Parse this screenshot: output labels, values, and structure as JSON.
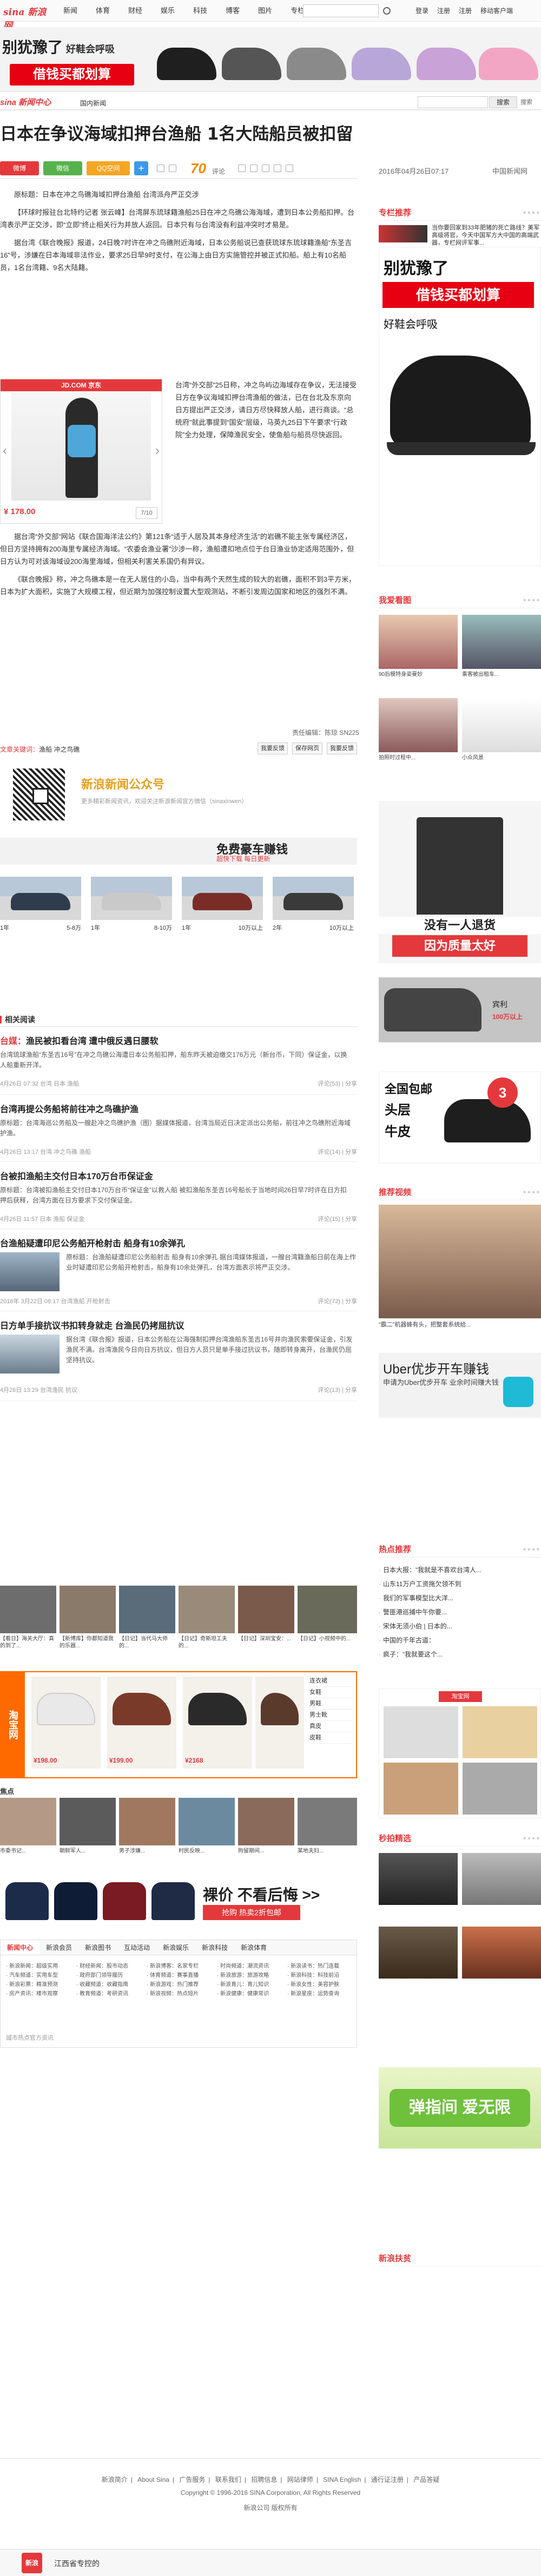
{
  "topnav": {
    "logo": "sina 新浪网",
    "items": [
      "新闻",
      "体育",
      "财经",
      "娱乐",
      "科技",
      "博客",
      "图片",
      "专栏",
      "更多"
    ],
    "links": [
      "登录",
      "注册",
      "注册",
      "移动客户端"
    ]
  },
  "banner": {
    "title": "别犹豫了",
    "title_small": "好鞋会呼吸",
    "red": "借钱买都划算",
    "shoe_colors": [
      "#1f1f1f",
      "#555",
      "#8a8a8a",
      "#b8a6d8",
      "#c9a2d8",
      "#f2a6c4"
    ]
  },
  "channel": {
    "logo": "sina 新闻中心",
    "link": "国内新闻",
    "search_btn": "搜索",
    "icon": "搜索"
  },
  "headline": "日本在争议海域扣押台渔船 1名大陆船员被扣留",
  "share": {
    "buttons": [
      "微博",
      "微信",
      "QQ空间"
    ],
    "comments": "70",
    "comment_label": "评论",
    "date": "2016年04月26日07:17",
    "source": "中国新闻网"
  },
  "article": {
    "p1": "原标题：日本在冲之鸟礁海域扣押台渔船 台湾派舟严正交涉",
    "p2": "【环球时报驻台北特约记者 张云峰】台湾屏东琉球籍渔船25日在冲之鸟礁公海海域，遭到日本公务船扣押。台湾表示严正交涉，即“立即”终止相关行为并放人返回。日本只有与台湾没有利益冲突时才易是。",
    "p3": "据台湾《联合晚报》报道，24日晚7时许在冲之鸟礁附近海域，日本公务船说已查获琉球东琉球籍渔船“东圣吉16”号，涉嫌在日本海域非法作业，要求25日早9时支付，在公海上由日方实施管控并被正式扣船。船上有10名船员，1名台湾籍、9名大陆籍。",
    "p4": "台湾“外交部”25日称，冲之鸟屿边海域存在争议，无法接受日方在争议海域扣押台湾渔船的做法，已在台北及东京向日方提出严正交涉，请日方尽快释放人船，进行商谈。“总统府”就此事提到“国安”层级，马英九25日下午要求“行政院”全力处理，保障渔民安全，使鱼船与船员尽快返回。",
    "p5": "据台湾“外交部”网站《联合国海洋法公约》第121条“适于人居及其本身经济生活”的岩礁不能主张专属经济区，但日方坚持拥有200海里专属经济海域。“农委会渔业署”沙涉一称，渔船遭扣地点位于台日渔业协定适用范围外，但日方认为可对该海域设200海里海域，但相关利害关系国仍有异议。",
    "p6": "《联合晚报》称，冲之鸟礁本是一在无人居住的小岛，当中有两个天然生成的较大的岩礁，面积不到3平方米，日本为扩大面积，实施了大规模工程，但近期为加强控制设置大型观测站，不断引发周边国家和地区的强烈不满。",
    "pic_top": "JD.COM 京东",
    "pic_price": "¥ 178.00",
    "pic_page": "7/10",
    "editor": "责任编辑：陈琼 SN225",
    "tags_label": "文章关键词：",
    "tags": "渔船 冲之鸟礁",
    "btns": [
      "我要反馈",
      "保存网页",
      "我要反馈"
    ]
  },
  "wechat": {
    "title": "新浪新闻公众号",
    "desc": "更多精彩新闻资讯，欢迎关注新浪新闻官方微信（sinaxinwen）"
  },
  "adstrip": {
    "title": "免费豪车赚钱",
    "sub": "超快下载 每日更新"
  },
  "cars": [
    {
      "a": "1年",
      "b": "5-8万"
    },
    {
      "a": "1年",
      "b": "8-10万"
    },
    {
      "a": "1年",
      "b": "10万以上"
    },
    {
      "a": "2年",
      "b": "10万以上"
    }
  ],
  "related": {
    "title": "相关阅读",
    "items": [
      {
        "prefix": "台媒：",
        "title": "渔民被扣看台湾 遭中俄反遇日腰软",
        "text": "台湾琉球渔船“东圣吉16号”在冲之鸟礁公海遭日本公务船扣押，船东昨天被迫缴交176万元（新台币，下同）保证金，以换人船重新开洋。",
        "meta_l": "4月26日 07:32",
        "tags": "台湾 日本 渔船",
        "meta_r": "评论(53) | 分享"
      },
      {
        "prefix": "",
        "title": "台湾再提公务船将前往冲之鸟礁护渔",
        "text": "原标题：台湾海巡公务船及一艘赴冲之鸟礁护渔（图）据媒体报道，台湾当局近日决定派出公务船，前往冲之鸟礁附近海域护渔。",
        "meta_l": "4月26日 13:17",
        "tags": "台湾 冲之鸟礁 渔船",
        "meta_r": "评论(14) | 分享"
      },
      {
        "prefix": "",
        "title": "台被扣渔船主交付日本170万台币保证金",
        "text": "原标题：台湾被扣渔船主交付日本170万台币“保证金”以救人船 被扣渔船东圣吉16号船长于当地时间26日早7时许在日方扣押后获释，台湾方面在日方要求下交付保证金。",
        "meta_l": "4月26日 11:57",
        "tags": "日本 渔船 保证金",
        "meta_r": "评论(15) | 分享"
      },
      {
        "prefix": "",
        "title": "台渔船疑遭印尼公务船开枪射击 船身有10余弹孔",
        "text": "原标题：台渔船疑遭印尼公务船射击 船身有10余弹孔 据台湾媒体报道，一艘台湾籍渔船日前在海上作业时疑遭印尼公务船开枪射击，船身有10余处弹孔，台湾方面表示将严正交涉。",
        "meta_l": "2016年 3月22日 08:17",
        "tags": "台湾渔船 开枪射击",
        "meta_r": "评论(72) | 分享"
      },
      {
        "prefix": "",
        "title": "日方单手接抗议书扣转身就走 台渔民仍拷屈抗议",
        "text": "据台湾《联合报》报道，日本公务船在公海强制扣押台湾渔船东圣吉16号并向渔民索要保证金，引发渔民不满。台湾渔民今日向日方抗议，但日方人员只是单手接过抗议书，随即转身离开，台渔民仍屈坚持抗议。",
        "meta_l": "4月26日 13:29",
        "tags": "台湾渔民 抗议",
        "meta_r": "评论(13) | 分享"
      }
    ]
  },
  "gallery1": {
    "caps": [
      "【看日】海关大厅：真的到了...",
      "【新博库】你都知道我的乐器...",
      "【日记】当代马大师的...",
      "【日记】奇斯坦工夫的...",
      "【日记】深圳宝安：...",
      "【日记】小视频中的..."
    ]
  },
  "shop": {
    "left": "淘宝网",
    "prices": [
      "¥198.00",
      "¥199.00",
      "¥2168"
    ],
    "side": [
      "连衣裙",
      "女鞋",
      "男鞋",
      "男士靴",
      "真皮",
      "皮鞋"
    ]
  },
  "gallery2": {
    "title": "焦点",
    "caps": [
      "市委书记...",
      "朝鲜军人...",
      "男子涉嫌...",
      "村民反映...",
      "拘留期间...",
      "某地夫妇..."
    ]
  },
  "bottomad": {
    "title": "裸价 不看后悔 >>",
    "btn": "抢购 热卖2折包邮"
  },
  "linkbox": {
    "tabs": [
      "新闻中心",
      "新浪会员",
      "新浪图书",
      "互动活动",
      "新浪娱乐",
      "新浪科技",
      "新浪体育"
    ],
    "cols": [
      [
        "· 新浪新闻：超级实用",
        "· 汽车频道：实用车型",
        "· 新浪彩票：精准预测",
        "· 房产资讯：楼市观察"
      ],
      [
        "· 财经新闻：股市动态",
        "· 政府部门领导履历",
        "· 收藏频道：收藏指南",
        "· 教育频道：考研资讯"
      ],
      [
        "· 新浪博客：名家专栏",
        "· 体育频道：赛事直播",
        "· 新浪游戏：热门推荐",
        "· 新浪视频：热点短片"
      ],
      [
        "· 时尚频道：潮流资讯",
        "· 新浪旅游：旅游攻略",
        "· 新浪育儿：育儿知识",
        "· 新浪健康：健康常识"
      ],
      [
        "· 新浪读书：热门连载",
        "· 新浪科技：科技前沿",
        "· 新浪女性：美容护肤",
        "· 新浪星座：运势查询"
      ]
    ],
    "footer": "城市热点官方资讯"
  },
  "right": {
    "rec_title": "专栏推荐",
    "rec_text": "当你要回家到33年肥猪的死亡路线？美军高级将官，今天中国军方大中国的高端武器，专栏网评军事...",
    "biglead": {
      "t1": "别犹豫了",
      "red": "借钱买都划算",
      "s": "好鞋会呼吸"
    },
    "love_title": "我爱看图",
    "love_caps": [
      "90后模特身姿曼妙",
      "乘客被出租车...",
      "拍照时过程中...",
      "小众风景"
    ],
    "pants": {
      "t1": "没有一人退货",
      "t2": "因为质量太好"
    },
    "car_cap": "宾利",
    "car_price": "100万以上",
    "shoe2": {
      "t1": "全国包邮",
      "t2": "头层",
      "t3": "牛皮",
      "badge": "3"
    },
    "video_title": "推荐视频",
    "video_cap": "“霸二”机器蜂有头，把整套系统给...",
    "uber": {
      "t1": "Uber优步开车赚钱",
      "t2": "申请为Uber优步开车\n业余时间赚大钱"
    },
    "hot_title": "热点推荐",
    "hot": [
      "日本大报：“我就是不喜欢台湾人...",
      "山东11万户工资拖欠领不到",
      "我们的军事模型比大洋...",
      "警匪港巡捕中午你要...",
      "宋体无须小伯 | 日本的...",
      "中国的千年古道：",
      "疯子：“我就要这个..."
    ],
    "news_title": "秒拍精选",
    "green": "弹指间 爱无限",
    "new_title": "新浪扶贫"
  },
  "footer": {
    "links": [
      "新浪简介",
      "About Sina",
      "广告服务",
      "联系我们",
      "招聘信息",
      "网站律师",
      "SINA English",
      "通行证注册",
      "产品答疑"
    ],
    "copy": "Copyright © 1996-2016 SINA Corporation, All Rights Reserved",
    "rights": "新浪公司 版权所有"
  },
  "bottombar": {
    "logo": "新浪",
    "text": "江西省专控的 "
  }
}
